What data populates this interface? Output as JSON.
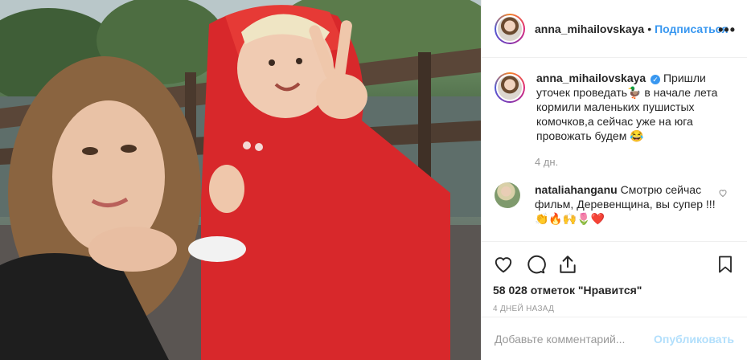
{
  "post": {
    "photo_alt": "photo",
    "author": {
      "username": "anna_mihailovskaya",
      "dot": "•",
      "follow_label": "Подписаться",
      "more_label": "•••"
    },
    "caption": {
      "username": "anna_mihailovskaya",
      "verified_icon": "verified-badge-icon",
      "text": "Пришли уточек проведать🦆 в начале лета кормили маленьких пушистых комочков,а сейчас уже на юга провожать будем 😂",
      "time": "4 дн."
    },
    "comments": [
      {
        "username": "nataliahanganu",
        "text": "Смотрю сейчас фильм, Деревенщина, вы супер !!!👏🔥🙌🌷❤️"
      }
    ],
    "likes": "58 028 отметок \"Нравится\"",
    "posted_ago": "4 ДНЕЙ НАЗАД",
    "add_comment": {
      "placeholder": "Добавьте комментарий...",
      "publish_label": "Опубликовать"
    },
    "colors": {
      "link": "#3897f0",
      "publish_disabled": "#b2dffc",
      "muted": "#999999"
    }
  }
}
